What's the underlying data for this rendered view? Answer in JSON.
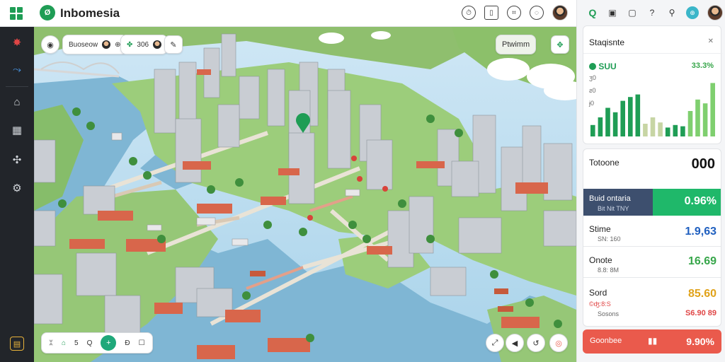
{
  "header": {
    "title": "Inbomesia",
    "logo_glyph": "Ø",
    "icons": [
      "timer-icon",
      "phone-icon",
      "tag-icon",
      "chat-icon",
      "user-avatar"
    ]
  },
  "sidebar": {
    "items": [
      {
        "name": "maple-leaf-icon",
        "glyph": "✸"
      },
      {
        "name": "route-icon",
        "glyph": "⤳"
      },
      {
        "name": "lock-icon",
        "glyph": "⌂"
      },
      {
        "name": "calendar-icon",
        "glyph": "▦"
      },
      {
        "name": "puzzle-icon",
        "glyph": "✣"
      },
      {
        "name": "settings-icon",
        "glyph": "⚙"
      }
    ],
    "bottom_glyph": "▤"
  },
  "map": {
    "top_toolbar": {
      "search_glyph": "◉",
      "chip_text": "Buoseow",
      "chip_glyph": "⊕",
      "group_text": "306",
      "edit_glyph": "✎"
    },
    "top_right_chip": {
      "label": "Ptwimm",
      "icon_glyph": "✥"
    },
    "bottom_toolbar": [
      "ᛯ",
      "⌂",
      "5",
      "Q",
      "+",
      "Ð",
      "☐"
    ],
    "bottom_right": [
      "⤢",
      "◀",
      "↺",
      "◎"
    ]
  },
  "right_panel": {
    "top_icons": [
      "Q",
      "▣",
      "▢",
      "?",
      "⚲",
      "⊕"
    ],
    "stats_card": {
      "title": "Staqisnte",
      "close_glyph": "✕",
      "legend_left": "SUU",
      "legend_right": "33.3%",
      "axis_labels": [
        "ʒ0",
        "ƨ0",
        "ɉ0"
      ],
      "bars": [
        {
          "v": 0.18,
          "c": "#1f9d55"
        },
        {
          "v": 0.3,
          "c": "#1f9d55"
        },
        {
          "v": 0.45,
          "c": "#1f9d55"
        },
        {
          "v": 0.38,
          "c": "#1f9d55"
        },
        {
          "v": 0.56,
          "c": "#1f9d55"
        },
        {
          "v": 0.62,
          "c": "#1f9d55"
        },
        {
          "v": 0.66,
          "c": "#1f9d55"
        },
        {
          "v": 0.2,
          "c": "#c7d5a4"
        },
        {
          "v": 0.3,
          "c": "#c7d5a4"
        },
        {
          "v": 0.22,
          "c": "#c7d5a4"
        },
        {
          "v": 0.14,
          "c": "#1f9d55"
        },
        {
          "v": 0.18,
          "c": "#1f9d55"
        },
        {
          "v": 0.16,
          "c": "#1f9d55"
        },
        {
          "v": 0.4,
          "c": "#7fcf6f"
        },
        {
          "v": 0.58,
          "c": "#7fcf6f"
        },
        {
          "v": 0.52,
          "c": "#7fcf6f"
        },
        {
          "v": 0.84,
          "c": "#7fcf6f"
        }
      ]
    },
    "metrics_card": {
      "title": "Totoone",
      "title_value": "000",
      "highlight": {
        "label": "Buid ontaria",
        "sub": "Bit Nit TNY",
        "value": "0.96%"
      },
      "rows": [
        {
          "label": "Stime",
          "sub": "SN: 160",
          "value": "1.9,63",
          "color": "#1f5fbf"
        },
        {
          "label": "Onote",
          "sub": "8.8: 8M",
          "value": "16.69",
          "color": "#37a64a"
        },
        {
          "label": "Sord",
          "sub": "©ʤ:8:S",
          "sub2": "Sosons",
          "value": "85.60",
          "value2": "S6.90 89",
          "color": "#e0a21a",
          "color2": "#e04646"
        }
      ]
    },
    "alert_bar": {
      "label": "Goonbee",
      "value": "9.90%",
      "glyph": "▮▮"
    }
  },
  "colors": {
    "accent_green": "#1f9d55",
    "highlight_navy": "#3d4f6e",
    "alert_red": "#ea5a4c",
    "water": "#7fb6d4"
  }
}
